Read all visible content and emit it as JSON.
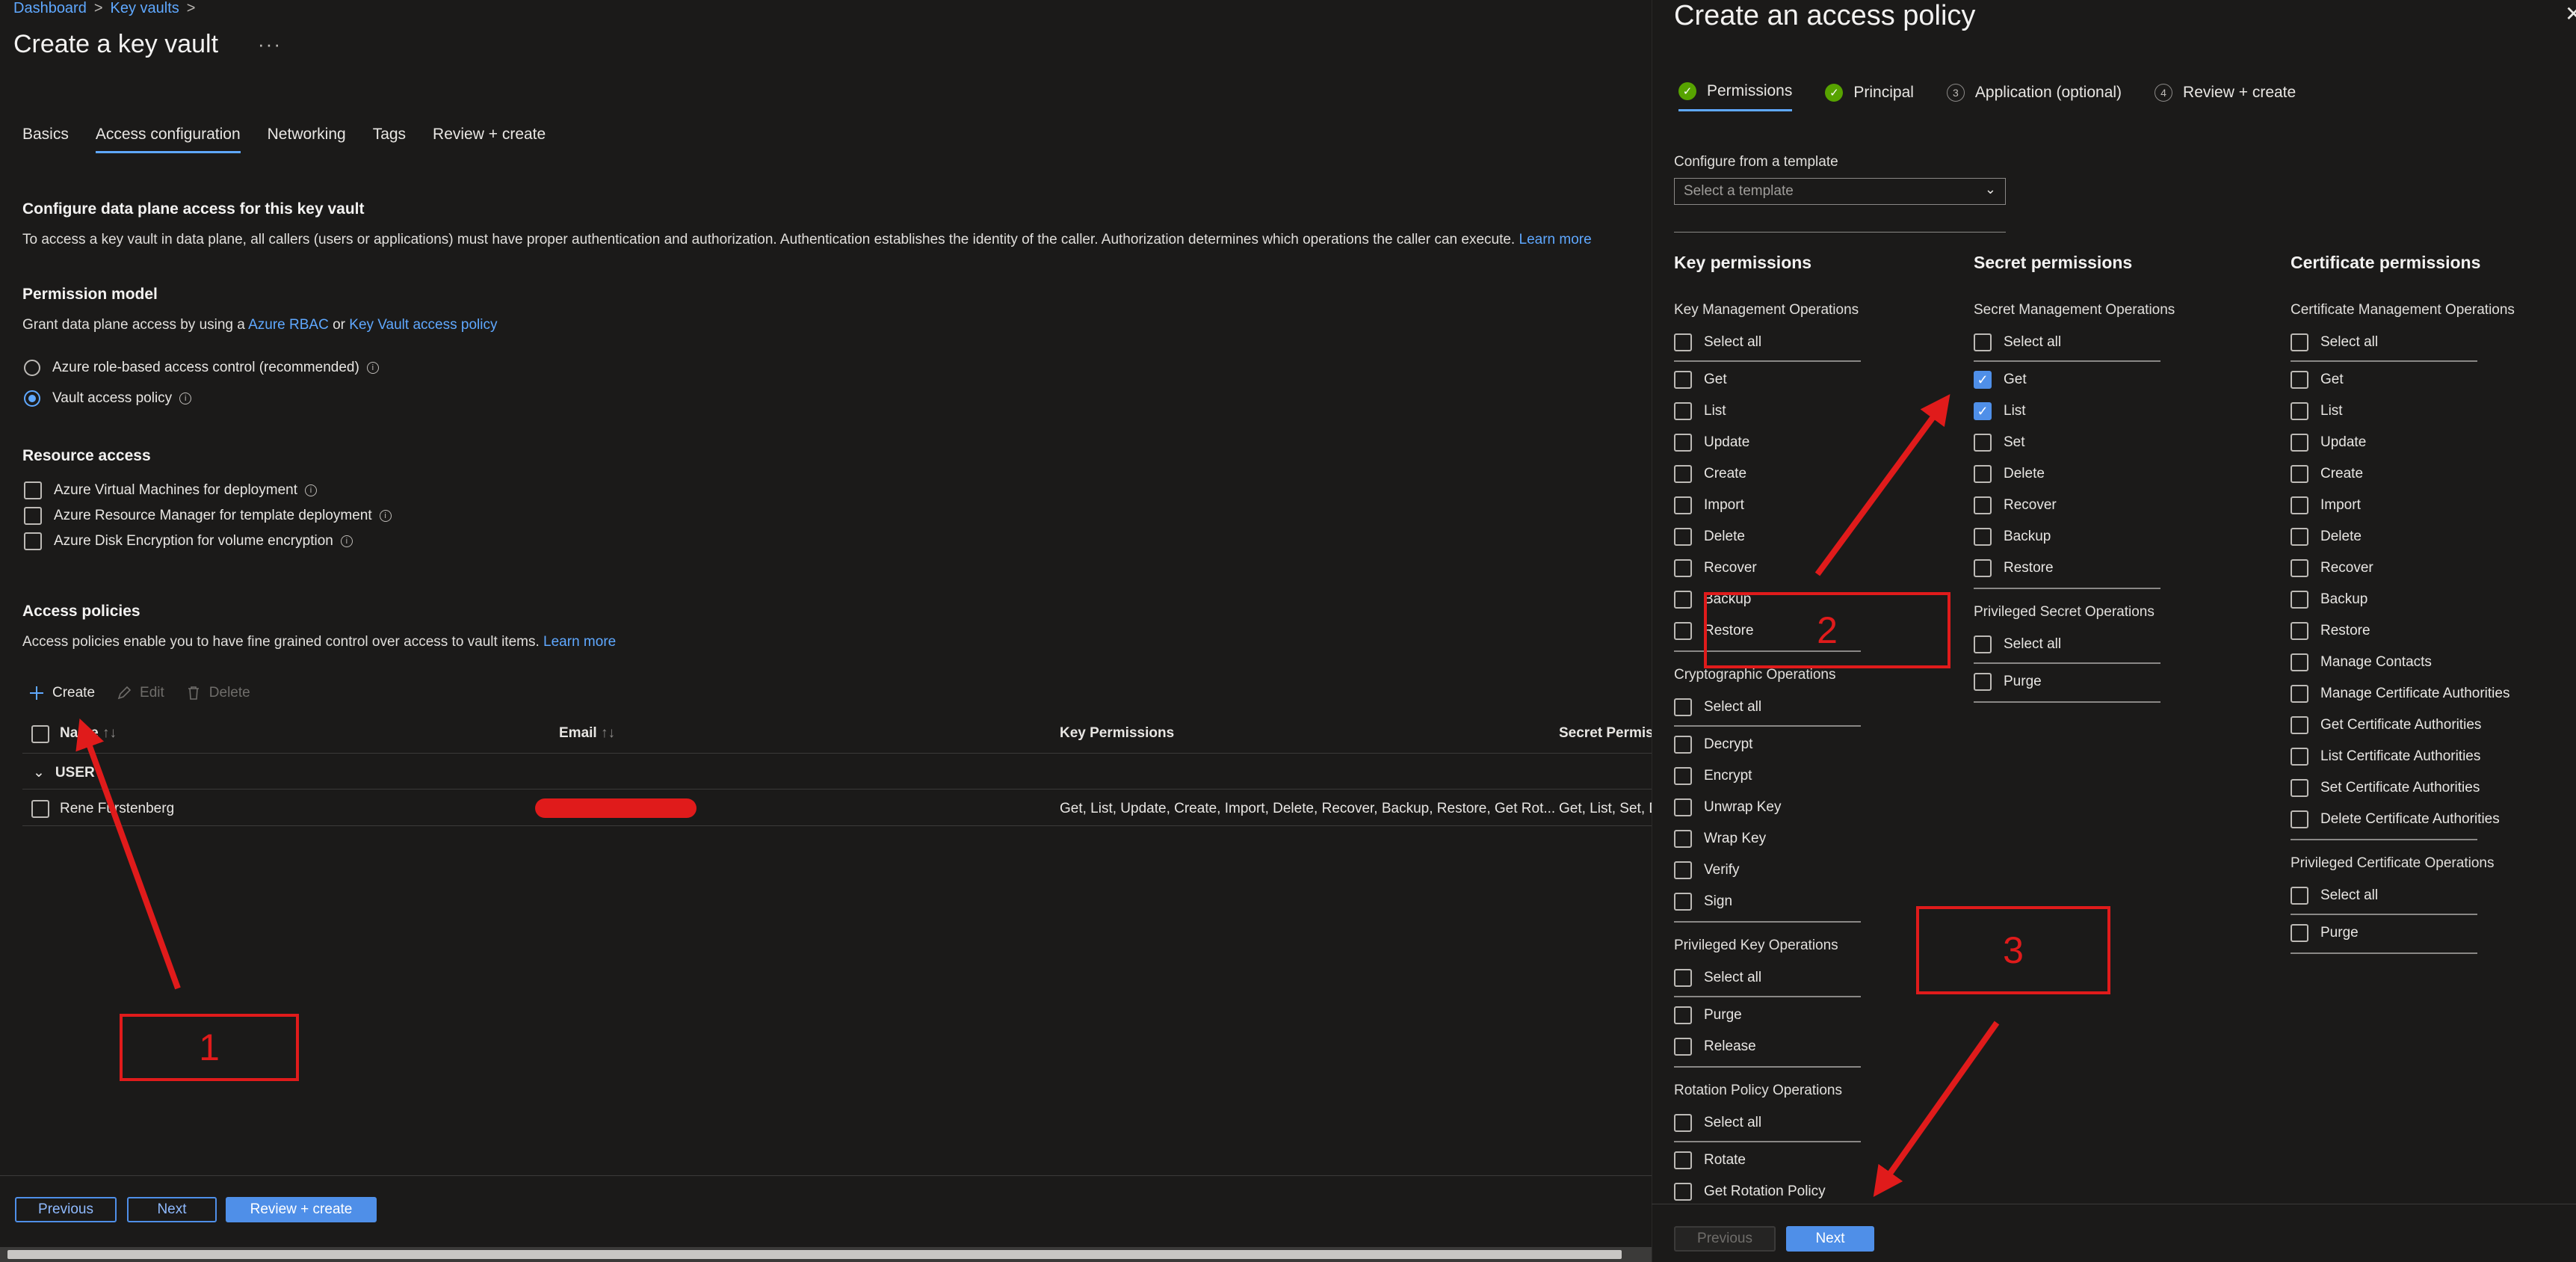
{
  "breadcrumb": {
    "items": [
      "Dashboard",
      "Key vaults"
    ]
  },
  "page": {
    "title": "Create a key vault",
    "more": "···"
  },
  "tabs": [
    "Basics",
    "Access configuration",
    "Networking",
    "Tags",
    "Review + create"
  ],
  "data_plane": {
    "heading": "Configure data plane access for this key vault",
    "desc": "To access a key vault in data plane, all callers (users or applications) must have proper authentication and authorization. Authentication establishes the identity of the caller. Authorization determines which operations the caller can execute.",
    "learn_more": "Learn more"
  },
  "permission_model": {
    "heading": "Permission model",
    "desc_prefix": "Grant data plane access by using a",
    "link1": "Azure RBAC",
    "or": "or",
    "link2": "Key Vault access policy",
    "options": [
      "Azure role-based access control (recommended)",
      "Vault access policy"
    ],
    "selected": "Vault access policy"
  },
  "resource_access": {
    "heading": "Resource access",
    "options": [
      "Azure Virtual Machines for deployment",
      "Azure Resource Manager for template deployment",
      "Azure Disk Encryption for volume encryption"
    ]
  },
  "access_policies": {
    "heading": "Access policies",
    "desc": "Access policies enable you to have fine grained control over access to vault items.",
    "learn_more": "Learn more",
    "toolbar": {
      "create": "Create",
      "edit": "Edit",
      "delete": "Delete"
    },
    "columns": {
      "name": "Name",
      "email": "Email",
      "key": "Key Permissions",
      "secret": "Secret Permiss"
    },
    "group": "USER",
    "row": {
      "name": "Rene Fürstenberg",
      "key": "Get, List, Update, Create, Import, Delete, Recover, Backup, Restore, Get Rot...",
      "secret": "Get, List, Set, D"
    }
  },
  "left_footer": {
    "previous": "Previous",
    "next": "Next",
    "review": "Review + create"
  },
  "panel": {
    "title": "Create an access policy",
    "close": "✕",
    "steps": [
      {
        "label": "Permissions",
        "state": "done",
        "num": "1"
      },
      {
        "label": "Principal",
        "state": "done",
        "num": "2"
      },
      {
        "label": "Application (optional)",
        "state": "todo",
        "num": "3"
      },
      {
        "label": "Review + create",
        "state": "todo",
        "num": "4"
      }
    ],
    "template_label": "Configure from a template",
    "template_placeholder": "Select a template",
    "columns": {
      "key": {
        "heading": "Key permissions",
        "groups": [
          {
            "title": "Key Management Operations",
            "items": [
              "Get",
              "List",
              "Update",
              "Create",
              "Import",
              "Delete",
              "Recover",
              "Backup",
              "Restore"
            ]
          },
          {
            "title": "Cryptographic Operations",
            "items": [
              "Decrypt",
              "Encrypt",
              "Unwrap Key",
              "Wrap Key",
              "Verify",
              "Sign"
            ]
          },
          {
            "title": "Privileged Key Operations",
            "items": [
              "Purge",
              "Release"
            ]
          },
          {
            "title": "Rotation Policy Operations",
            "items": [
              "Rotate",
              "Get Rotation Policy"
            ]
          }
        ]
      },
      "secret": {
        "heading": "Secret permissions",
        "groups": [
          {
            "title": "Secret Management Operations",
            "items": [
              "Get",
              "List",
              "Set",
              "Delete",
              "Recover",
              "Backup",
              "Restore"
            ],
            "checked": [
              "Get",
              "List"
            ]
          },
          {
            "title": "Privileged Secret Operations",
            "items": [
              "Purge"
            ]
          }
        ]
      },
      "cert": {
        "heading": "Certificate permissions",
        "groups": [
          {
            "title": "Certificate Management Operations",
            "items": [
              "Get",
              "List",
              "Update",
              "Create",
              "Import",
              "Delete",
              "Recover",
              "Backup",
              "Restore",
              "Manage Contacts",
              "Manage Certificate Authorities",
              "Get Certificate Authorities",
              "List Certificate Authorities",
              "Set Certificate Authorities",
              "Delete Certificate Authorities"
            ]
          },
          {
            "title": "Privileged Certificate Operations",
            "items": [
              "Purge"
            ]
          }
        ]
      }
    },
    "select_all": "Select all",
    "footer": {
      "previous": "Previous",
      "next": "Next"
    }
  },
  "annotations": [
    "1",
    "2",
    "3"
  ],
  "colors": {
    "accent": "#4f8fe8",
    "annotation": "#e01b1b",
    "success": "#57a300"
  },
  "icons": {
    "create": "plus-icon",
    "edit": "pencil-icon",
    "delete": "trash-icon",
    "sort": "sort-arrows-icon",
    "expand": "chevron-down-icon"
  }
}
